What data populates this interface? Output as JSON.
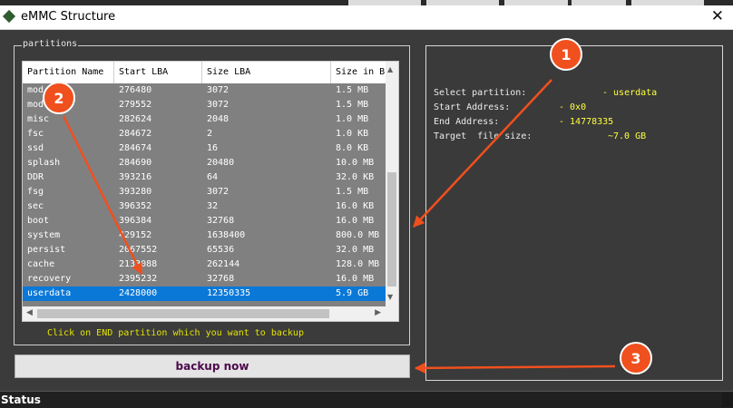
{
  "window": {
    "title": "eMMC Structure",
    "close_glyph": "✕"
  },
  "partitions_group": {
    "label": "partitions",
    "columns": [
      "Partition Name",
      "Start LBA",
      "Size LBA",
      "Size in B"
    ],
    "rows": [
      [
        "mod",
        "276480",
        "3072",
        "1.5 MB"
      ],
      [
        "mod",
        "279552",
        "3072",
        "1.5 MB"
      ],
      [
        "misc",
        "282624",
        "2048",
        "1.0 MB"
      ],
      [
        "fsc",
        "284672",
        "2",
        "1.0 KB"
      ],
      [
        "ssd",
        "284674",
        "16",
        "8.0 KB"
      ],
      [
        "splash",
        "284690",
        "20480",
        "10.0 MB"
      ],
      [
        "DDR",
        "393216",
        "64",
        "32.0 KB"
      ],
      [
        "fsg",
        "393280",
        "3072",
        "1.5 MB"
      ],
      [
        "sec",
        "396352",
        "32",
        "16.0 KB"
      ],
      [
        "boot",
        "396384",
        "32768",
        "16.0 MB"
      ],
      [
        "system",
        "429152",
        "1638400",
        "800.0 MB"
      ],
      [
        "persist",
        "2067552",
        "65536",
        "32.0 MB"
      ],
      [
        "cache",
        "2133088",
        "262144",
        "128.0 MB"
      ],
      [
        "recovery",
        "2395232",
        "32768",
        "16.0 MB"
      ],
      [
        "userdata",
        "2428000",
        "12350335",
        "5.9 GB"
      ]
    ],
    "selected_row_index": 14,
    "hint": "Click on END partition which you want to backup"
  },
  "backup_button": {
    "label": "backup now"
  },
  "info_panel": {
    "select_partition_label": "Select partition:",
    "select_partition_value": "- userdata",
    "start_address_label": "Start Address:",
    "start_address_value": "- 0x0",
    "end_address_label": "End Address:",
    "end_address_value": "- 14778335",
    "target_size_label": "Target  file size:",
    "target_size_value": "~7.0 GB"
  },
  "status_bar": {
    "label": "Status"
  },
  "annotations": {
    "marker_1": "1",
    "marker_2": "2",
    "marker_3": "3",
    "color": "#f0501e"
  },
  "colors": {
    "selected_row": "#0a78d7",
    "hint_text": "#e4e400",
    "info_value": "#ffff40",
    "button_text": "#4b0a4b"
  }
}
